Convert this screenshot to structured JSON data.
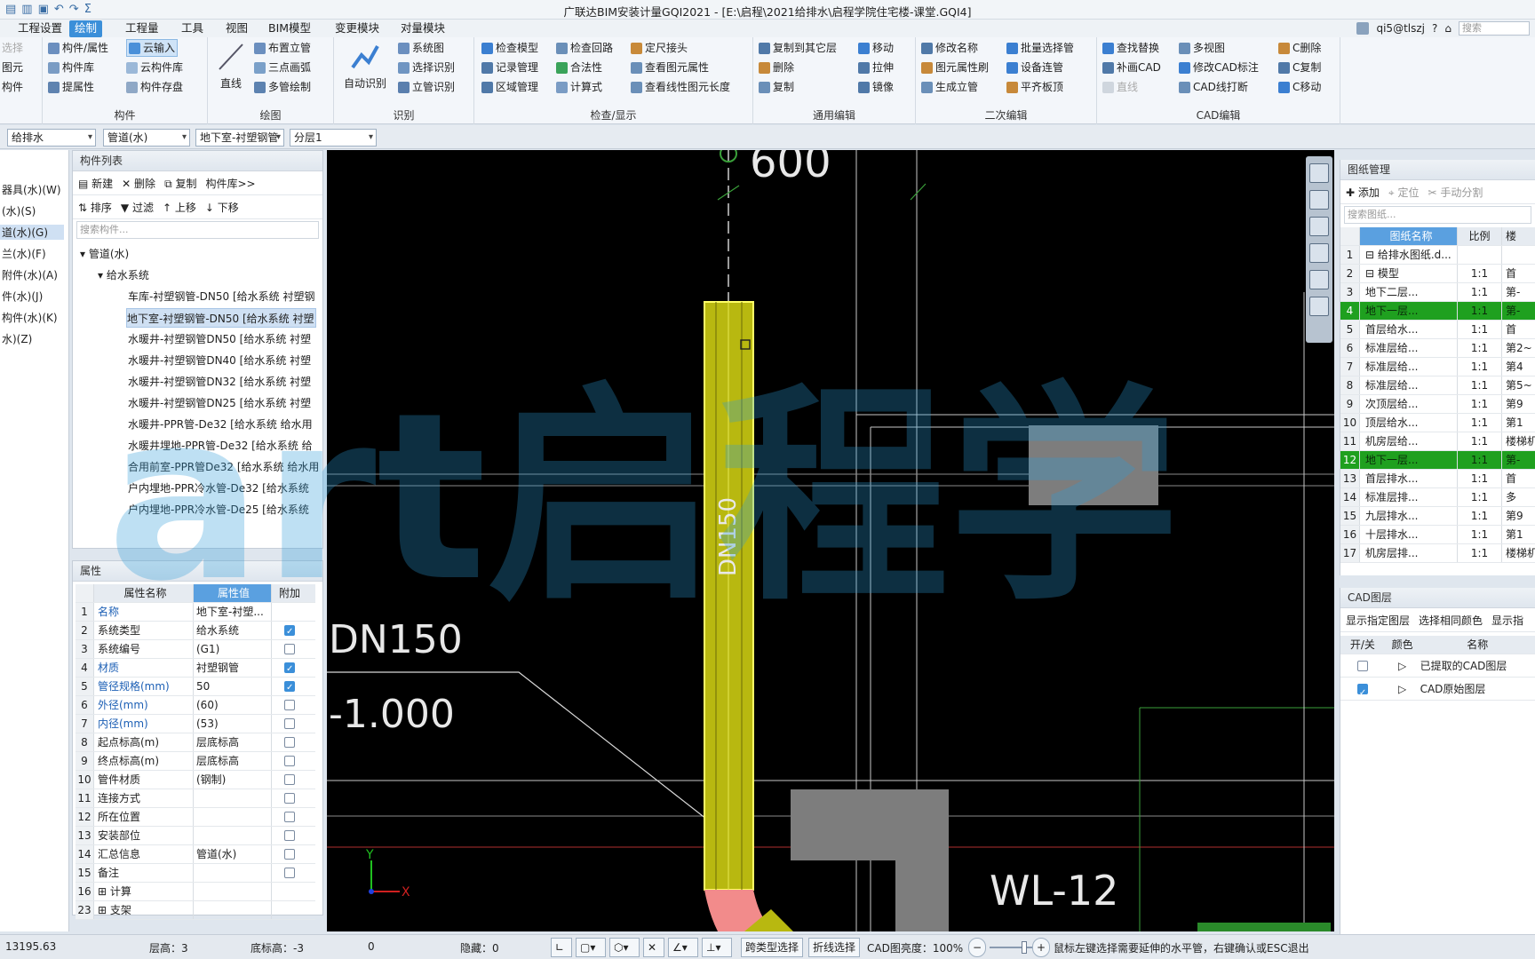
{
  "app": {
    "title": "广联达BIM安装计量GQI2021 - [E:\\启程\\2021给排水\\启程学院住宅楼-课堂.GQI4]"
  },
  "menu": {
    "tabs": [
      "工程设置",
      "绘制",
      "工程量",
      "工具",
      "视图",
      "BIM模型",
      "变更模块",
      "对量模块"
    ],
    "active": 1
  },
  "user": {
    "name": "qi5@tlszj",
    "search_placeholder": "搜索"
  },
  "ribbon": {
    "g0": {
      "items": [
        "选择",
        "图元",
        "构件"
      ]
    },
    "goujian": {
      "title": "构件",
      "items": [
        "构件/属性",
        "云输入",
        "构件库",
        "云构件库",
        "提属性",
        "构件存盘"
      ]
    },
    "huitu": {
      "title": "绘图",
      "big": "直线",
      "items": [
        "布置立管",
        "三点画弧",
        "多管绘制"
      ]
    },
    "shibie": {
      "title": "识别",
      "big": "自动识别",
      "items": [
        "系统图",
        "选择识别",
        "立管识别"
      ]
    },
    "jiancha": {
      "title": "检查/显示",
      "items": [
        "检查模型",
        "检查回路",
        "定尺接头",
        "记录管理",
        "合法性",
        "查看图元属性",
        "区域管理",
        "计算式",
        "查看线性图元长度"
      ]
    },
    "tongyong": {
      "title": "通用编辑",
      "items": [
        "复制到其它层",
        "移动",
        "删除",
        "拉伸",
        "复制",
        "镜像"
      ]
    },
    "erci": {
      "title": "二次编辑",
      "items": [
        "修改名称",
        "批量选择管",
        "图元属性刷",
        "设备连管",
        "生成立管",
        "平齐板顶"
      ]
    },
    "cad": {
      "title": "CAD编辑",
      "items": [
        "查找替换",
        "多视图",
        "C删除",
        "补画CAD",
        "修改CAD标注",
        "C复制",
        "直线",
        "CAD线打断",
        "C移动"
      ]
    }
  },
  "combos": [
    "给排水",
    "管道(水)",
    "地下室-衬塑钢管",
    "分层1"
  ],
  "leftstub": [
    "选择",
    "器具(水)(W)",
    "(水)(S)",
    "道(水)(G)",
    "兰(水)(F)",
    "附件(水)(A)",
    "件(水)(J)",
    "构件(水)(K)",
    "水)(Z)"
  ],
  "complist": {
    "title": "构件列表",
    "toolbar": [
      "新建",
      "删除",
      "复制",
      "构件库>>"
    ],
    "toolbar2": [
      "排序",
      "过滤",
      "上移",
      "下移"
    ],
    "search_placeholder": "搜索构件...",
    "root": "管道(水)",
    "sub": "给水系统",
    "items": [
      "车库-衬塑钢管-DN50 [给水系统 衬塑钢",
      "地下室-衬塑钢管-DN50 [给水系统 衬塑",
      "水暖井-衬塑钢管DN50 [给水系统 衬塑",
      "水暖井-衬塑钢管DN40 [给水系统 衬塑",
      "水暖井-衬塑钢管DN32 [给水系统 衬塑",
      "水暖井-衬塑钢管DN25 [给水系统 衬塑",
      "水暖井-PPR管-De32 [给水系统 给水用",
      "水暖井埋地-PPR管-De32 [给水系统 给",
      "合用前室-PPR管De32 [给水系统 给水用",
      "户内埋地-PPR冷水管-De32 [给水系统",
      "户内埋地-PPR冷水管-De25 [给水系统"
    ]
  },
  "props": {
    "title": "属性",
    "headers": [
      "属性名称",
      "属性值",
      "附加"
    ],
    "rows": [
      {
        "n": "1",
        "k": "名称",
        "v": "地下室-衬塑...",
        "c": null,
        "blue": true
      },
      {
        "n": "2",
        "k": "系统类型",
        "v": "给水系统",
        "c": true,
        "blue": false
      },
      {
        "n": "3",
        "k": "系统编号",
        "v": "(G1)",
        "c": false,
        "blue": false
      },
      {
        "n": "4",
        "k": "材质",
        "v": "衬塑钢管",
        "c": true,
        "blue": true
      },
      {
        "n": "5",
        "k": "管径规格(mm)",
        "v": "50",
        "c": true,
        "blue": true
      },
      {
        "n": "6",
        "k": "外径(mm)",
        "v": "(60)",
        "c": false,
        "blue": true
      },
      {
        "n": "7",
        "k": "内径(mm)",
        "v": "(53)",
        "c": false,
        "blue": true
      },
      {
        "n": "8",
        "k": "起点标高(m)",
        "v": "层底标高",
        "c": false,
        "blue": false
      },
      {
        "n": "9",
        "k": "终点标高(m)",
        "v": "层底标高",
        "c": false,
        "blue": false
      },
      {
        "n": "10",
        "k": "管件材质",
        "v": "(钢制)",
        "c": false,
        "blue": false
      },
      {
        "n": "11",
        "k": "连接方式",
        "v": "",
        "c": false,
        "blue": false
      },
      {
        "n": "12",
        "k": "所在位置",
        "v": "",
        "c": false,
        "blue": false
      },
      {
        "n": "13",
        "k": "安装部位",
        "v": "",
        "c": false,
        "blue": false
      },
      {
        "n": "14",
        "k": "汇总信息",
        "v": "管道(水)",
        "c": false,
        "blue": false
      },
      {
        "n": "15",
        "k": "备注",
        "v": "",
        "c": false,
        "blue": false
      },
      {
        "n": "16",
        "k": "⊞ 计算",
        "v": "",
        "c": null,
        "blue": false
      },
      {
        "n": "23",
        "k": "⊞ 支架",
        "v": "",
        "c": null,
        "blue": false
      }
    ]
  },
  "canvas": {
    "label_top": "600",
    "label_pipe": "DN150",
    "label_left": "DN150",
    "label_elev": "-1.000",
    "label_wl": "WL-12",
    "axis_x": "X",
    "axis_y": "Y",
    "watermark": "art启程学"
  },
  "drawings": {
    "title": "图纸管理",
    "toolbar": [
      "添加",
      "定位",
      "手动分割"
    ],
    "search_placeholder": "搜索图纸...",
    "headers": [
      "图纸名称",
      "比例",
      "楼"
    ],
    "rows": [
      {
        "n": "1",
        "nm": "⊟ 给排水图纸.d...",
        "sc": "",
        "fl": "",
        "g": false
      },
      {
        "n": "2",
        "nm": "  ⊟ 模型",
        "sc": "1:1",
        "fl": "首",
        "g": false
      },
      {
        "n": "3",
        "nm": "    地下二层...",
        "sc": "1:1",
        "fl": "第-",
        "g": false
      },
      {
        "n": "4",
        "nm": "    地下一层...",
        "sc": "1:1",
        "fl": "第-",
        "g": true
      },
      {
        "n": "5",
        "nm": "    首层给水...",
        "sc": "1:1",
        "fl": "首",
        "g": false
      },
      {
        "n": "6",
        "nm": "    标准层给...",
        "sc": "1:1",
        "fl": "第2~",
        "g": false
      },
      {
        "n": "7",
        "nm": "    标准层给...",
        "sc": "1:1",
        "fl": "第4",
        "g": false
      },
      {
        "n": "8",
        "nm": "    标准层给...",
        "sc": "1:1",
        "fl": "第5~",
        "g": false
      },
      {
        "n": "9",
        "nm": "    次顶层给...",
        "sc": "1:1",
        "fl": "第9",
        "g": false
      },
      {
        "n": "10",
        "nm": "    顶层给水...",
        "sc": "1:1",
        "fl": "第1",
        "g": false
      },
      {
        "n": "11",
        "nm": "    机房层给...",
        "sc": "1:1",
        "fl": "楼梯机",
        "g": false
      },
      {
        "n": "12",
        "nm": "    地下一层...",
        "sc": "1:1",
        "fl": "第-",
        "g": true
      },
      {
        "n": "13",
        "nm": "    首层排水...",
        "sc": "1:1",
        "fl": "首",
        "g": false
      },
      {
        "n": "14",
        "nm": "    标准层排...",
        "sc": "1:1",
        "fl": "多",
        "g": false
      },
      {
        "n": "15",
        "nm": "    九层排水...",
        "sc": "1:1",
        "fl": "第9",
        "g": false
      },
      {
        "n": "16",
        "nm": "    十层排水...",
        "sc": "1:1",
        "fl": "第1",
        "g": false
      },
      {
        "n": "17",
        "nm": "    机房层排...",
        "sc": "1:1",
        "fl": "楼梯机",
        "g": false
      }
    ]
  },
  "cadlayers": {
    "title": "CAD图层",
    "toolbar": [
      "显示指定图层",
      "选择相同颜色",
      "显示指"
    ],
    "headers": [
      "开/关",
      "颜色",
      "名称"
    ],
    "rows": [
      {
        "name": "已提取的CAD图层",
        "on": false
      },
      {
        "name": "CAD原始图层",
        "on": true
      }
    ]
  },
  "status": {
    "coord": "13195.63",
    "floor": "层高：3",
    "base": "底标高：-3",
    "zero": "0",
    "hidden": "隐藏：0",
    "btn_cross": "跨类型选择",
    "btn_poly": "折线选择",
    "brightness": "CAD图亮度：100%",
    "hint": "鼠标左键选择需要延伸的水平管，右键确认或ESC退出"
  },
  "colors": {
    "accent": "#3b8fd9",
    "pipe": "#c9c90f",
    "highlight": "#1fa01f"
  }
}
